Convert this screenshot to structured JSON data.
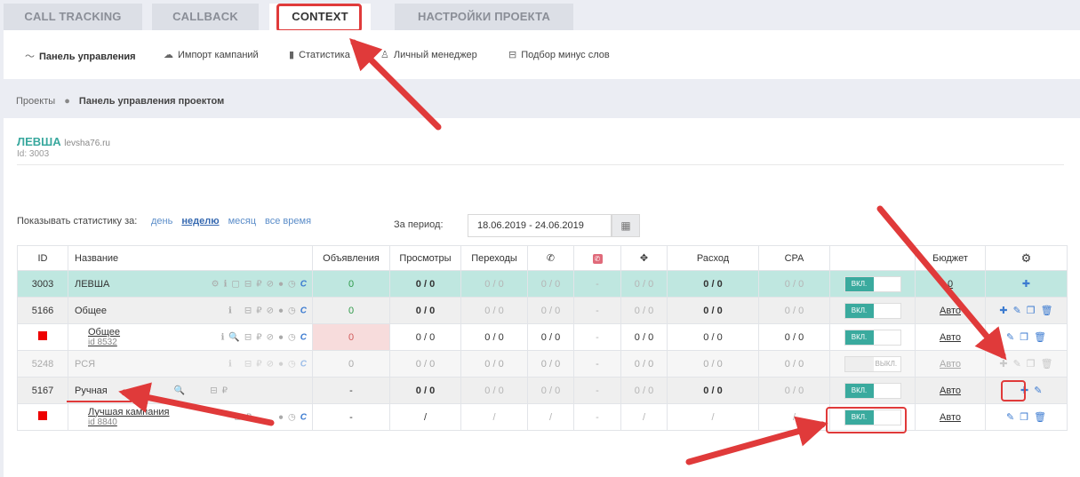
{
  "tabs": [
    {
      "label": "CALL TRACKING"
    },
    {
      "label": "CALLBACK"
    },
    {
      "label": "CONTEXT"
    },
    {
      "label": "НАСТРОЙКИ ПРОЕКТА"
    }
  ],
  "subnav": [
    {
      "label": "Панель управления",
      "icon": "chart-line-icon"
    },
    {
      "label": "Импорт кампаний",
      "icon": "cloud-upload-icon"
    },
    {
      "label": "Статистика",
      "icon": "bar-chart-icon"
    },
    {
      "label": "Личный менеджер",
      "icon": "user-icon"
    },
    {
      "label": "Подбор минус слов",
      "icon": "minus-square-icon"
    }
  ],
  "breadcrumb": {
    "items": [
      "Проекты",
      "Панель управления проектом"
    ]
  },
  "project": {
    "name": "ЛЕВША",
    "domain": "levsha76.ru",
    "id_text": "Id: 3003"
  },
  "stats": {
    "label": "Показывать статистику за:",
    "periods": [
      "день",
      "неделю",
      "месяц",
      "все время"
    ],
    "period_label": "За период:",
    "date_range": "18.06.2019 - 24.06.2019"
  },
  "table": {
    "headers": [
      "ID",
      "Название",
      "Объявления",
      "Просмотры",
      "Переходы",
      "",
      "",
      "",
      "Расход",
      "CPA",
      "",
      "Бюджет",
      ""
    ],
    "rows": [
      {
        "id": "3003",
        "name": "ЛЕВША",
        "sub": "",
        "ads": "0",
        "views": "0 / 0",
        "clicks": "0 / 0",
        "calls": "0 / 0",
        "missed": "-",
        "goals": "0 / 0",
        "spend": "0 / 0",
        "cpa": "0 / 0",
        "toggle": "ВКЛ.",
        "budget": "0"
      },
      {
        "id": "5166",
        "name": "Общее",
        "sub": "",
        "ads": "0",
        "views": "0 / 0",
        "clicks": "0 / 0",
        "calls": "0 / 0",
        "missed": "-",
        "goals": "0 / 0",
        "spend": "0 / 0",
        "cpa": "0 / 0",
        "toggle": "ВКЛ.",
        "budget": "Авто"
      },
      {
        "id": "",
        "name": "Общее",
        "sub": "id 8532",
        "ads": "0",
        "views": "0 / 0",
        "clicks": "0 / 0",
        "calls": "0 / 0",
        "missed": "-",
        "goals": "0 / 0",
        "spend": "0 / 0",
        "cpa": "0 / 0",
        "toggle": "ВКЛ.",
        "budget": "Авто"
      },
      {
        "id": "5248",
        "name": "РСЯ",
        "sub": "",
        "ads": "0",
        "views": "0 / 0",
        "clicks": "0 / 0",
        "calls": "0 / 0",
        "missed": "-",
        "goals": "0 / 0",
        "spend": "0 / 0",
        "cpa": "0 / 0",
        "toggle": "ВЫКЛ.",
        "budget": "Авто"
      },
      {
        "id": "5167",
        "name": "Ручная",
        "sub": "",
        "ads": "-",
        "views": "0 / 0",
        "clicks": "0 / 0",
        "calls": "0 / 0",
        "missed": "-",
        "goals": "0 / 0",
        "spend": "0 / 0",
        "cpa": "0 / 0",
        "toggle": "ВКЛ.",
        "budget": "Авто"
      },
      {
        "id": "",
        "name": "Лучшая кампания",
        "sub": "id 8840",
        "ads": "-",
        "views": "/",
        "clicks": "/",
        "calls": "/",
        "missed": "-",
        "goals": "/",
        "spend": "/",
        "cpa": "/",
        "toggle": "ВКЛ.",
        "budget": "Авто"
      }
    ]
  },
  "colors": {
    "accent": "#3aaa9e",
    "highlight": "#e03a3a",
    "link": "#3c7bd0"
  }
}
